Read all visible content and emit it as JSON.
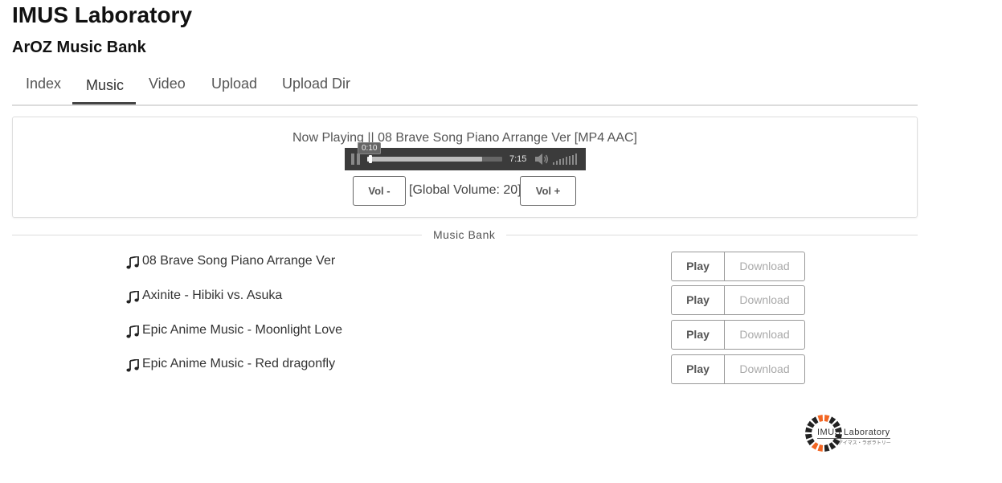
{
  "header": {
    "site_title": "IMUS Laboratory",
    "page_title": "ArOZ Music Bank"
  },
  "tabs": [
    {
      "label": "Index",
      "active": false
    },
    {
      "label": "Music",
      "active": true
    },
    {
      "label": "Video",
      "active": false
    },
    {
      "label": "Upload",
      "active": false
    },
    {
      "label": "Upload Dir",
      "active": false
    }
  ],
  "player": {
    "now_playing": "Now Playing || 08 Brave Song Piano Arrange Ver [MP4 AAC]",
    "current_time": "0:10",
    "duration": "7:15",
    "progress_fraction": 0.023,
    "buffered_fraction": 0.85,
    "vol_down_label": "Vol -",
    "vol_up_label": "Vol +",
    "global_volume_text": "[Global Volume: 20]"
  },
  "bank": {
    "label": "Music Bank",
    "play_label": "Play",
    "download_label": "Download",
    "tracks": [
      {
        "name": "08 Brave Song Piano Arrange Ver"
      },
      {
        "name": "Axinite - Hibiki vs. Asuka"
      },
      {
        "name": "Epic Anime Music - Moonlight Love"
      },
      {
        "name": "Epic Anime Music - Red dragonfly"
      }
    ]
  },
  "logo": {
    "title": "IMUS Laboratory",
    "subtitle": "アイマス・ラボラトリー"
  },
  "colors": {
    "logo_accent": "#f26522",
    "audio_bar": "#3b3b3b"
  }
}
